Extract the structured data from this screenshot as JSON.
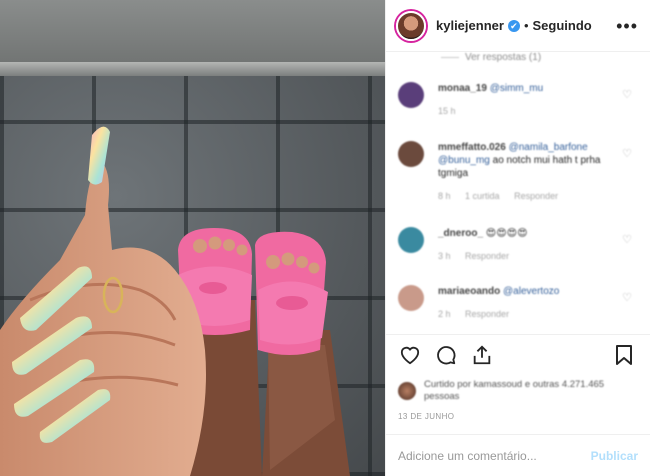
{
  "header": {
    "username": "kyliejenner",
    "verified_glyph": "✔",
    "separator": "•",
    "follow_status": "Seguindo",
    "more_glyph": "•••"
  },
  "comments": {
    "view_replies": "Ver respostas (1)",
    "items": [
      {
        "user": "monaa_19",
        "mention": "@simm_mu",
        "text": "",
        "time": "15 h",
        "likes": "",
        "reply": "",
        "avatar_color": "#5a3e7a"
      },
      {
        "user": "mmeffatto.026",
        "mention": "@namila_barfone @bunu_mg",
        "text": "ao notch mui hath t prha tgmiga",
        "time": "8 h",
        "likes": "1 curtida",
        "reply": "Responder",
        "avatar_color": "#6b4a3d"
      },
      {
        "user": "_dneroo_",
        "mention": "",
        "text": "😍😍😍😍",
        "time": "3 h",
        "likes": "",
        "reply": "Responder",
        "avatar_color": "#3a8aa0"
      },
      {
        "user": "mariaeoando",
        "mention": "@alevertozo",
        "text": "",
        "time": "2 h",
        "likes": "",
        "reply": "Responder",
        "avatar_color": "#c99a8a"
      }
    ]
  },
  "likes": {
    "text": "Curtido por kamassoud e outras 4.271.465 pessoas"
  },
  "date": "13 DE JUNHO",
  "add_comment": {
    "placeholder": "Adicione um comentário...",
    "publish_label": "Publicar"
  },
  "icons": {
    "like": "heart-icon",
    "comment": "comment-icon",
    "share": "share-icon",
    "save": "bookmark-icon"
  }
}
